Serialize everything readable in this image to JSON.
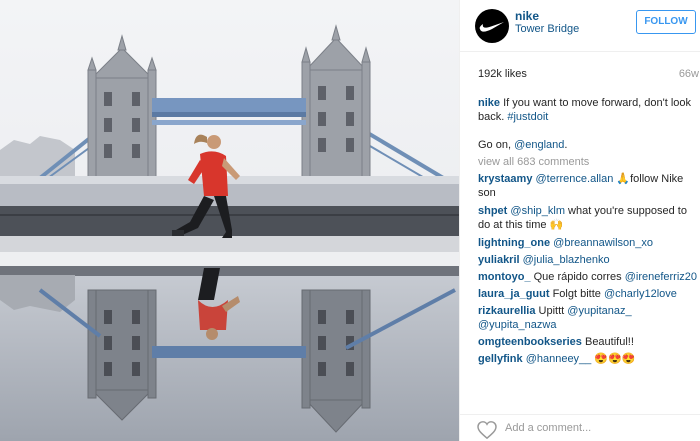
{
  "post": {
    "user": "nike",
    "location": "Tower Bridge",
    "follow_label": "FOLLOW",
    "likes": "192k likes",
    "time_ago": "66w"
  },
  "caption": {
    "author": "nike",
    "text": " If you want to move forward, don't look back. ",
    "hashtag": "#justdoit"
  },
  "reply": {
    "prefix": "Go on, ",
    "mention": "@england",
    "suffix": "."
  },
  "view_all": "view all 683 comments",
  "comments": [
    {
      "author": "krystaamy",
      "mention": "@terrence.allan",
      "text": " 🙏follow Nike son"
    },
    {
      "author": "shpet",
      "mention": "@ship_klm",
      "text": " what you're supposed to do at this time 🙌"
    },
    {
      "author": "lightning_one",
      "mention": "@breannawilson_xo",
      "text": ""
    },
    {
      "author": "yuliakril",
      "mention": "@julia_blazhenko",
      "text": ""
    },
    {
      "author": "montoyo_",
      "mention": "",
      "text": " Que rápido corres ",
      "mention2": "@ireneferriz20"
    },
    {
      "author": "laura_ja_guut",
      "mention": "",
      "text": " Folgt bitte ",
      "mention2": "@charly12love"
    },
    {
      "author": "rizkaurellia",
      "mention": "",
      "text": " Upittt ",
      "mention2": "@yupitanaz_ @yupita_nazwa"
    },
    {
      "author": "omgteenbookseries",
      "mention": "",
      "text": " Beautiful!!"
    },
    {
      "author": "gellyfink",
      "mention": "@hanneey__",
      "text": " 😍😍😍"
    }
  ],
  "add_comment_placeholder": "Add a comment...",
  "colors": {
    "link": "#125688",
    "follow": "#3897f0",
    "muted": "#999999"
  },
  "icons": {
    "avatar_logo": "nike-swoosh-icon",
    "like": "heart-icon"
  }
}
